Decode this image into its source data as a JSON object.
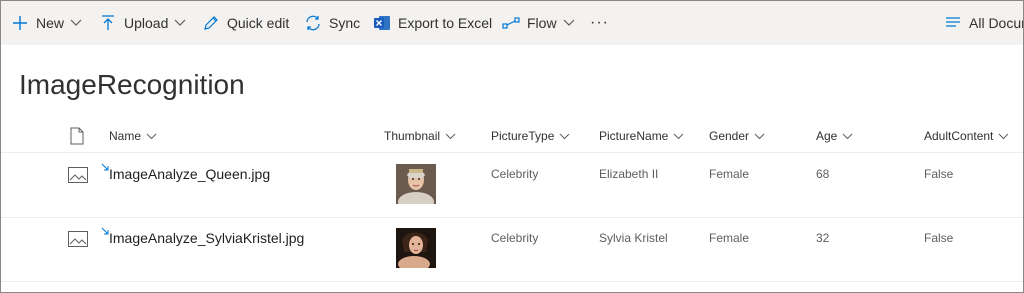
{
  "commandbar": {
    "new_label": "New",
    "upload_label": "Upload",
    "quick_edit_label": "Quick edit",
    "sync_label": "Sync",
    "export_label": "Export to Excel",
    "flow_label": "Flow",
    "more_label": "···",
    "view_label": "All Docur"
  },
  "library": {
    "title": "ImageRecognition"
  },
  "columns": {
    "name": "Name",
    "thumbnail": "Thumbnail",
    "picture_type": "PictureType",
    "picture_name": "PictureName",
    "gender": "Gender",
    "age": "Age",
    "adult_content": "AdultContent"
  },
  "rows": [
    {
      "file_name": "ImageAnalyze_Queen.jpg",
      "picture_type": "Celebrity",
      "picture_name": "Elizabeth II",
      "gender": "Female",
      "age": "68",
      "adult_content": "False"
    },
    {
      "file_name": "ImageAnalyze_SylviaKristel.jpg",
      "picture_type": "Celebrity",
      "picture_name": "Sylvia Kristel",
      "gender": "Female",
      "age": "32",
      "adult_content": "False"
    }
  ],
  "colors": {
    "accent": "#0078d4",
    "commandbar_bg": "#f3f2f1",
    "excel_green": "#217346"
  },
  "icons": {
    "new": "plus-icon",
    "upload": "upload-arrow-icon",
    "quick_edit": "pencil-icon",
    "sync": "sync-icon",
    "export": "excel-icon",
    "flow": "flow-icon",
    "view": "list-icon",
    "file_type": "image-file-icon"
  }
}
